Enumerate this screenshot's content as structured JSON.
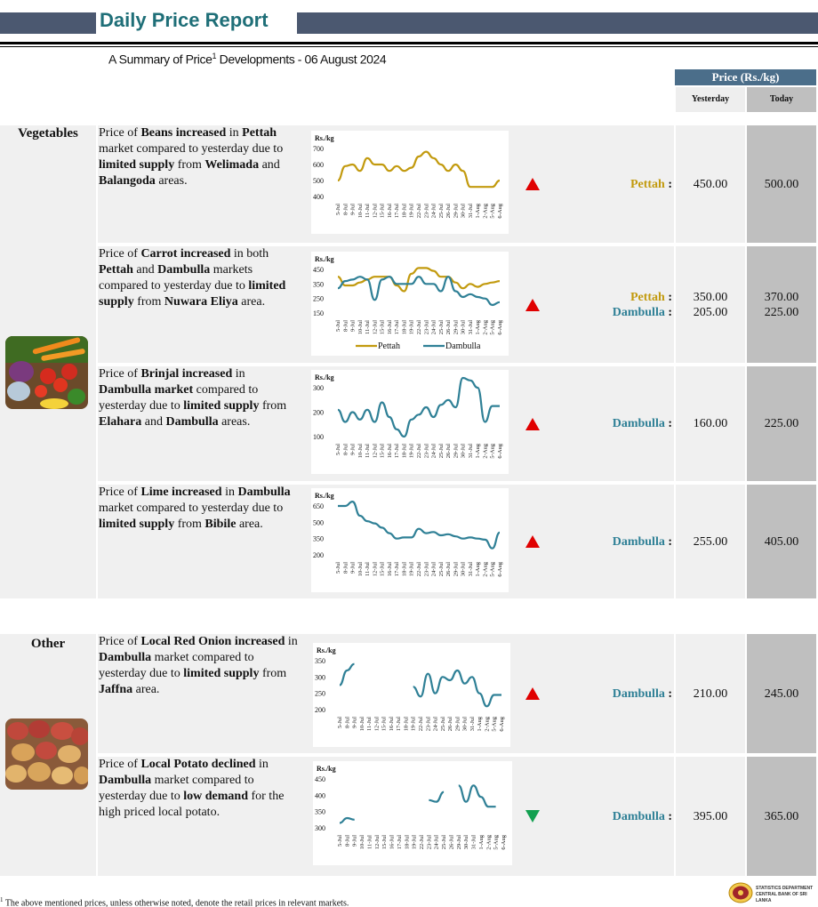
{
  "header": {
    "title": "Daily Price Report"
  },
  "subtitle": {
    "prefix": "A Summary of Price",
    "footnote_mark": "1",
    "middle": " Developments - ",
    "date": "06 August 2024"
  },
  "table_header": {
    "price": "Price (Rs./kg)",
    "yesterday": "Yesterday",
    "today": "Today"
  },
  "colors": {
    "pettah": "#c29a0e",
    "dambulla": "#2f8096",
    "up": "#e00000",
    "down": "#12a050",
    "header_bar": "#4b5870",
    "title": "#1f6f78"
  },
  "categories": [
    {
      "label": "Vegetables",
      "image_icon": "vegetables-photo"
    },
    {
      "label": "Other",
      "image_icon": "onion-potato-photo"
    }
  ],
  "x_dates": [
    "5-Jul",
    "8-Jul",
    "9-Jul",
    "10-Jul",
    "11-Jul",
    "12-Jul",
    "15-Jul",
    "16-Jul",
    "17-Jul",
    "18-Jul",
    "19-Jul",
    "22-Jul",
    "23-Jul",
    "24-Jul",
    "25-Jul",
    "26-Jul",
    "29-Jul",
    "30-Jul",
    "31-Jul",
    "1-Aug",
    "2-Aug",
    "5-Aug",
    "6-Aug"
  ],
  "rows": [
    {
      "desc": [
        {
          "t": "Price of ",
          "b": false
        },
        {
          "t": "Beans increased",
          "b": true
        },
        {
          "t": " in ",
          "b": false
        },
        {
          "t": "Pettah",
          "b": true
        },
        {
          "t": " market compared to yesterday due to ",
          "b": false
        },
        {
          "t": "limited supply",
          "b": true
        },
        {
          "t": " from ",
          "b": false
        },
        {
          "t": "Welimada",
          "b": true
        },
        {
          "t": " and ",
          "b": false
        },
        {
          "t": "Balangoda",
          "b": true
        },
        {
          "t": " areas.",
          "b": false
        }
      ],
      "direction": "up",
      "markets": [
        {
          "name": "Pettah",
          "color": "#c29a0e",
          "yesterday": "450.00",
          "today": "500.00"
        }
      ],
      "chart_data": {
        "type": "line",
        "ylabel": "Rs./kg",
        "yticks": [
          400,
          500,
          600,
          700
        ],
        "ylim": [
          400,
          700
        ],
        "legend": false,
        "series": [
          {
            "name": "Pettah",
            "color": "#c29a0e",
            "values": [
              500,
              590,
              600,
              560,
              640,
              600,
              600,
              560,
              590,
              560,
              580,
              650,
              680,
              640,
              600,
              560,
              600,
              560,
              460,
              460,
              460,
              460,
              500
            ]
          }
        ]
      }
    },
    {
      "desc": [
        {
          "t": "Price of ",
          "b": false
        },
        {
          "t": "Carrot increased",
          "b": true
        },
        {
          "t": " in both ",
          "b": false
        },
        {
          "t": "Pettah",
          "b": true
        },
        {
          "t": " and ",
          "b": false
        },
        {
          "t": "Dambulla",
          "b": true
        },
        {
          "t": " markets compared to yesterday due to ",
          "b": false
        },
        {
          "t": "limited supply",
          "b": true
        },
        {
          "t": " from ",
          "b": false
        },
        {
          "t": "Nuwara Eliya",
          "b": true
        },
        {
          "t": " area.",
          "b": false
        }
      ],
      "direction": "up",
      "markets": [
        {
          "name": "Pettah",
          "color": "#c29a0e",
          "yesterday": "350.00",
          "today": "370.00"
        },
        {
          "name": "Dambulla",
          "color": "#2f8096",
          "yesterday": "205.00",
          "today": "225.00"
        }
      ],
      "chart_data": {
        "type": "line",
        "ylabel": "Rs./kg",
        "yticks": [
          150,
          250,
          350,
          450
        ],
        "ylim": [
          150,
          450
        ],
        "legend": true,
        "series": [
          {
            "name": "Pettah",
            "color": "#c29a0e",
            "values": [
              400,
              340,
              340,
              360,
              380,
              400,
              400,
              400,
              340,
              300,
              420,
              460,
              460,
              440,
              400,
              400,
              360,
              320,
              350,
              330,
              350,
              360,
              370
            ]
          },
          {
            "name": "Dambulla",
            "color": "#2f8096",
            "values": [
              320,
              370,
              380,
              400,
              380,
              240,
              380,
              400,
              350,
              350,
              350,
              400,
              350,
              350,
              300,
              400,
              300,
              260,
              280,
              260,
              250,
              205,
              225
            ]
          }
        ]
      }
    },
    {
      "desc": [
        {
          "t": "Price of ",
          "b": false
        },
        {
          "t": "Brinjal increased",
          "b": true
        },
        {
          "t": " in ",
          "b": false
        },
        {
          "t": "Dambulla market",
          "b": true
        },
        {
          "t": " compared to yesterday due to ",
          "b": false
        },
        {
          "t": "limited supply",
          "b": true
        },
        {
          "t": " from ",
          "b": false
        },
        {
          "t": "Elahara",
          "b": true
        },
        {
          "t": " and ",
          "b": false
        },
        {
          "t": "Dambulla",
          "b": true
        },
        {
          "t": " areas.",
          "b": false
        }
      ],
      "direction": "up",
      "markets": [
        {
          "name": "Dambulla",
          "color": "#2f8096",
          "yesterday": "160.00",
          "today": "225.00"
        }
      ],
      "chart_data": {
        "type": "line",
        "ylabel": "Rs./kg",
        "yticks": [
          100,
          200,
          300
        ],
        "ylim": [
          100,
          300
        ],
        "legend": false,
        "series": [
          {
            "name": "Dambulla",
            "color": "#2f8096",
            "values": [
              210,
              160,
              200,
              170,
              210,
              160,
              240,
              180,
              130,
              100,
              170,
              190,
              220,
              180,
              230,
              250,
              220,
              340,
              330,
              300,
              160,
              225,
              225
            ]
          }
        ]
      }
    },
    {
      "desc": [
        {
          "t": "Price of ",
          "b": false
        },
        {
          "t": "Lime increased",
          "b": true
        },
        {
          "t": " in ",
          "b": false
        },
        {
          "t": "Dambulla",
          "b": true
        },
        {
          "t": " market compared to yesterday due to ",
          "b": false
        },
        {
          "t": "limited supply",
          "b": true
        },
        {
          "t": " from ",
          "b": false
        },
        {
          "t": "Bibile",
          "b": true
        },
        {
          "t": " area.",
          "b": false
        }
      ],
      "direction": "up",
      "markets": [
        {
          "name": "Dambulla",
          "color": "#2f8096",
          "yesterday": "255.00",
          "today": "405.00"
        }
      ],
      "chart_data": {
        "type": "line",
        "ylabel": "Rs./kg",
        "yticks": [
          200,
          350,
          500,
          650
        ],
        "ylim": [
          200,
          650
        ],
        "legend": false,
        "series": [
          {
            "name": "Dambulla",
            "color": "#2f8096",
            "values": [
              650,
              650,
              690,
              560,
              510,
              490,
              450,
              400,
              350,
              360,
              360,
              440,
              400,
              410,
              380,
              390,
              370,
              350,
              360,
              350,
              340,
              260,
              405
            ]
          }
        ]
      }
    },
    {
      "desc": [
        {
          "t": "Price of ",
          "b": false
        },
        {
          "t": "Local Red Onion increased",
          "b": true
        },
        {
          "t": " in ",
          "b": false
        },
        {
          "t": "Dambulla",
          "b": true
        },
        {
          "t": " market compared to yesterday due to ",
          "b": false
        },
        {
          "t": "limited supply",
          "b": true
        },
        {
          "t": " from ",
          "b": false
        },
        {
          "t": "Jaffna",
          "b": true
        },
        {
          "t": " area.",
          "b": false
        }
      ],
      "direction": "up",
      "markets": [
        {
          "name": "Dambulla",
          "color": "#2f8096",
          "yesterday": "210.00",
          "today": "245.00"
        }
      ],
      "chart_data": {
        "type": "line",
        "ylabel": "Rs./kg",
        "yticks": [
          200,
          250,
          300,
          350
        ],
        "ylim": [
          200,
          350
        ],
        "legend": false,
        "series": [
          {
            "name": "Dambulla",
            "color": "#2f8096",
            "values": [
              275,
              320,
              340,
              null,
              null,
              null,
              null,
              null,
              null,
              null,
              270,
              240,
              310,
              250,
              300,
              290,
              320,
              280,
              300,
              250,
              210,
              245,
              245
            ]
          }
        ]
      }
    },
    {
      "desc": [
        {
          "t": "Price of ",
          "b": false
        },
        {
          "t": "Local Potato declined",
          "b": true
        },
        {
          "t": " in ",
          "b": false
        },
        {
          "t": "Dambulla",
          "b": true
        },
        {
          "t": " market compared to yesterday due to ",
          "b": false
        },
        {
          "t": "low demand",
          "b": true
        },
        {
          "t": " for the high priced local potato.",
          "b": false
        }
      ],
      "direction": "down",
      "markets": [
        {
          "name": "Dambulla",
          "color": "#2f8096",
          "yesterday": "395.00",
          "today": "365.00"
        }
      ],
      "chart_data": {
        "type": "line",
        "ylabel": "Rs./kg",
        "yticks": [
          300,
          350,
          400,
          450
        ],
        "ylim": [
          300,
          450
        ],
        "legend": false,
        "series": [
          {
            "name": "Dambulla",
            "color": "#2f8096",
            "values": [
              315,
              330,
              325,
              null,
              null,
              null,
              null,
              null,
              null,
              null,
              null,
              null,
              385,
              380,
              410,
              null,
              430,
              380,
              430,
              395,
              365,
              365,
              null
            ]
          }
        ]
      }
    }
  ],
  "footnote": {
    "mark": "1",
    "text": " The above mentioned prices, unless otherwise noted, denote the retail prices in relevant markets."
  },
  "logo": {
    "line1": "STATISTICS DEPARTMENT",
    "line2": "CENTRAL BANK OF SRI LANKA"
  }
}
